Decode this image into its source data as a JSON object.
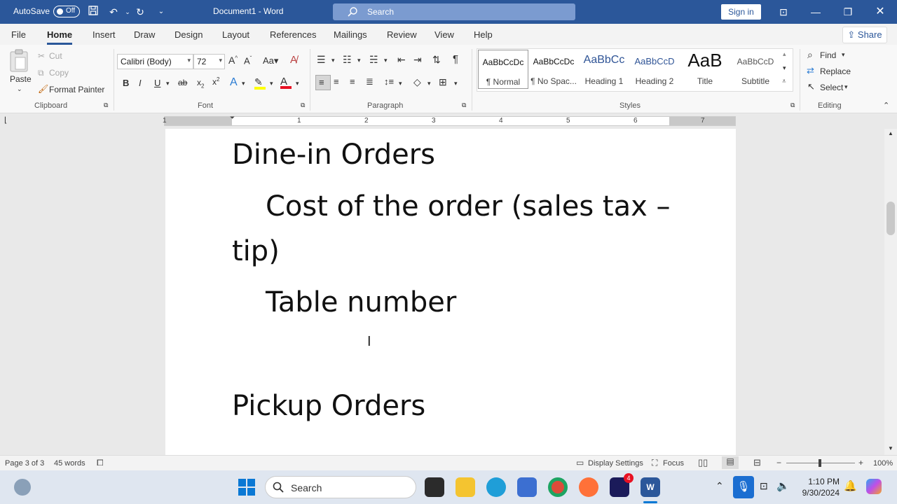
{
  "titlebar": {
    "autosave_label": "AutoSave",
    "autosave_state": "Off",
    "document_title": "Document1  -  Word",
    "search_placeholder": "Search",
    "sign_in": "Sign in"
  },
  "menu": {
    "tabs": [
      "File",
      "Home",
      "Insert",
      "Draw",
      "Design",
      "Layout",
      "References",
      "Mailings",
      "Review",
      "View",
      "Help"
    ],
    "active_tab": "Home",
    "share": "Share"
  },
  "ribbon": {
    "clipboard": {
      "paste": "Paste",
      "cut": "Cut",
      "copy": "Copy",
      "format_painter": "Format Painter",
      "label": "Clipboard"
    },
    "font": {
      "name": "Calibri (Body)",
      "size": "72",
      "bold": "B",
      "italic": "I",
      "underline": "U",
      "label": "Font",
      "case": "Aa"
    },
    "paragraph": {
      "label": "Paragraph"
    },
    "styles": {
      "items": [
        {
          "preview": "AaBbCcDc",
          "name": "¶ Normal"
        },
        {
          "preview": "AaBbCcDc",
          "name": "¶ No Spac..."
        },
        {
          "preview": "AaBbCc",
          "name": "Heading 1"
        },
        {
          "preview": "AaBbCcD",
          "name": "Heading 2"
        },
        {
          "preview": "AaB",
          "name": "Title"
        },
        {
          "preview": "AaBbCcD",
          "name": "Subtitle"
        }
      ],
      "label": "Styles"
    },
    "editing": {
      "find": "Find",
      "replace": "Replace",
      "select": "Select",
      "label": "Editing"
    }
  },
  "ruler": {
    "numbers": [
      "1",
      "1",
      "2",
      "3",
      "4",
      "5",
      "6",
      "7"
    ]
  },
  "document": {
    "lines": [
      "Dine-in Orders",
      "Cost of the order (sales tax –",
      "tip)",
      "Table number",
      "Pickup Orders"
    ]
  },
  "status": {
    "page": "Page 3 of 3",
    "words": "45 words",
    "display_settings": "Display Settings",
    "focus": "Focus",
    "zoom": "100%"
  },
  "taskbar": {
    "search": "Search",
    "time": "1:10 PM",
    "date": "9/30/2024",
    "badge": "4"
  },
  "colors": {
    "word_blue": "#2b579a",
    "font_red": "#e81123",
    "highlight_yellow": "#ffff00"
  }
}
